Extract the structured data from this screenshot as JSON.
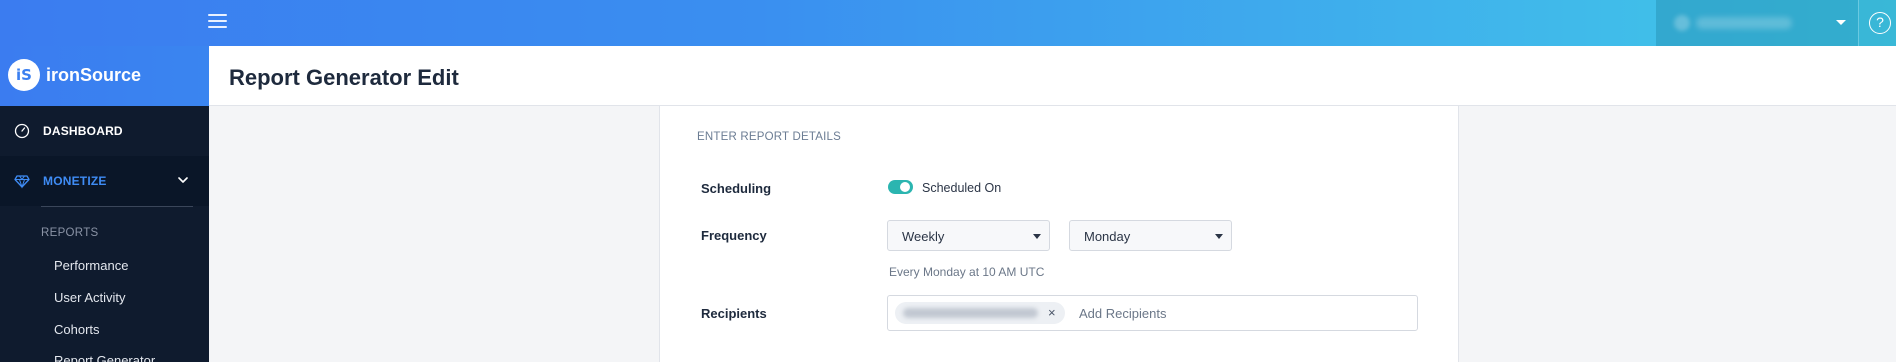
{
  "topbar": {
    "menu_icon": "hamburger-icon",
    "help_label": "?"
  },
  "brand": {
    "logo_text": "iS",
    "name": "ironSource"
  },
  "sidebar": {
    "dashboard_label": "DASHBOARD",
    "monetize_label": "MONETIZE",
    "reports_heading": "REPORTS",
    "report_items": [
      "Performance",
      "User Activity",
      "Cohorts",
      "Report Generator"
    ]
  },
  "page": {
    "title": "Report Generator Edit"
  },
  "form": {
    "section_title": "ENTER REPORT DETAILS",
    "scheduling_label": "Scheduling",
    "scheduling_value": "Scheduled On",
    "scheduling_on": true,
    "frequency_label": "Frequency",
    "frequency_value": "Weekly",
    "day_value": "Monday",
    "frequency_hint": "Every Monday at 10 AM UTC",
    "recipients_label": "Recipients",
    "recipients_placeholder": "Add Recipients",
    "chip_remove": "×"
  },
  "colors": {
    "brand_blue": "#3b7cf0",
    "sidebar_bg": "#0f1b2e",
    "accent_teal": "#2bb5b0",
    "active_nav": "#3f8cf5"
  }
}
